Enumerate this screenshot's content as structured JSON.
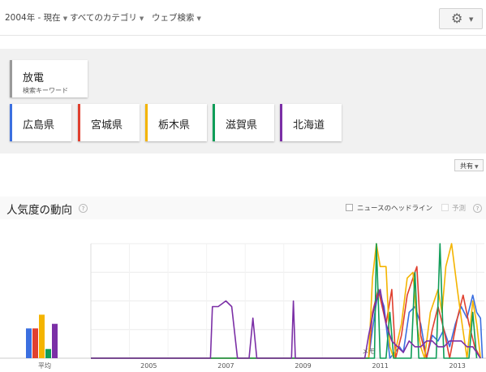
{
  "filters": {
    "time": "2004年 - 現在",
    "category": "すべてのカテゴリ",
    "search_type": "ウェブ検索"
  },
  "settings_icon": "gear-icon",
  "main_term": {
    "label": "放電",
    "sub": "検索キーワード"
  },
  "regions": [
    {
      "label": "広島県",
      "color": "#3b6fe0"
    },
    {
      "label": "宮城県",
      "color": "#e0402f"
    },
    {
      "label": "栃木県",
      "color": "#f4b400"
    },
    {
      "label": "滋賀県",
      "color": "#0f9d58"
    },
    {
      "label": "北海道",
      "color": "#7b2fa6"
    }
  ],
  "share_label": "共有",
  "section": {
    "title": "人気度の動向",
    "help": "?",
    "news_headlines": "ニュースのヘッドライン",
    "forecast": "予測"
  },
  "chart_data": {
    "type": "line",
    "x_ticks": [
      "2005",
      "2007",
      "2009",
      "2011",
      "2013"
    ],
    "average_label": "平均",
    "note_label": "メモ",
    "ylim": [
      0,
      100
    ],
    "average": [
      {
        "name": "広島県",
        "value": 26
      },
      {
        "name": "宮城県",
        "value": 26
      },
      {
        "name": "栃木県",
        "value": 38
      },
      {
        "name": "滋賀県",
        "value": 8
      },
      {
        "name": "北海道",
        "value": 30
      }
    ],
    "series": [
      {
        "name": "広島県",
        "points": [
          [
            2004.0,
            0
          ],
          [
            2011.2,
            0
          ],
          [
            2011.3,
            25
          ],
          [
            2011.45,
            60
          ],
          [
            2011.6,
            45
          ],
          [
            2011.75,
            0
          ],
          [
            2012.0,
            10
          ],
          [
            2012.1,
            5
          ],
          [
            2012.25,
            40
          ],
          [
            2012.4,
            45
          ],
          [
            2012.55,
            30
          ],
          [
            2012.7,
            0
          ],
          [
            2012.85,
            20
          ],
          [
            2013.0,
            15
          ],
          [
            2013.15,
            25
          ],
          [
            2013.3,
            10
          ],
          [
            2013.45,
            30
          ],
          [
            2013.6,
            45
          ],
          [
            2013.75,
            35
          ],
          [
            2013.9,
            55
          ],
          [
            2014.0,
            40
          ],
          [
            2014.1,
            35
          ],
          [
            2014.15,
            0
          ]
        ]
      },
      {
        "name": "宮城県",
        "points": [
          [
            2004.0,
            0
          ],
          [
            2011.2,
            0
          ],
          [
            2011.3,
            40
          ],
          [
            2011.45,
            60
          ],
          [
            2011.55,
            45
          ],
          [
            2011.65,
            30
          ],
          [
            2011.8,
            60
          ],
          [
            2011.9,
            0
          ],
          [
            2012.05,
            20
          ],
          [
            2012.2,
            55
          ],
          [
            2012.35,
            70
          ],
          [
            2012.45,
            80
          ],
          [
            2012.55,
            20
          ],
          [
            2012.7,
            0
          ],
          [
            2012.85,
            25
          ],
          [
            2013.0,
            45
          ],
          [
            2013.15,
            25
          ],
          [
            2013.3,
            0
          ],
          [
            2013.5,
            35
          ],
          [
            2013.65,
            55
          ],
          [
            2013.8,
            30
          ],
          [
            2013.95,
            10
          ],
          [
            2014.1,
            0
          ]
        ]
      },
      {
        "name": "栃木県",
        "points": [
          [
            2004.0,
            0
          ],
          [
            2011.2,
            0
          ],
          [
            2011.3,
            70
          ],
          [
            2011.4,
            100
          ],
          [
            2011.5,
            80
          ],
          [
            2011.65,
            80
          ],
          [
            2011.75,
            10
          ],
          [
            2011.85,
            0
          ],
          [
            2012.05,
            30
          ],
          [
            2012.2,
            70
          ],
          [
            2012.35,
            75
          ],
          [
            2012.45,
            30
          ],
          [
            2012.55,
            10
          ],
          [
            2012.65,
            0
          ],
          [
            2012.8,
            40
          ],
          [
            2013.0,
            60
          ],
          [
            2013.1,
            40
          ],
          [
            2013.2,
            80
          ],
          [
            2013.35,
            100
          ],
          [
            2013.5,
            60
          ],
          [
            2013.6,
            35
          ],
          [
            2013.75,
            0
          ],
          [
            2013.9,
            50
          ],
          [
            2014.0,
            30
          ],
          [
            2014.1,
            0
          ]
        ]
      },
      {
        "name": "滋賀県",
        "points": [
          [
            2004.0,
            0
          ],
          [
            2011.35,
            0
          ],
          [
            2011.4,
            100
          ],
          [
            2011.5,
            0
          ],
          [
            2011.65,
            0
          ],
          [
            2011.75,
            40
          ],
          [
            2011.85,
            0
          ],
          [
            2012.3,
            0
          ],
          [
            2012.4,
            75
          ],
          [
            2012.5,
            0
          ],
          [
            2012.95,
            0
          ],
          [
            2013.05,
            100
          ],
          [
            2013.15,
            0
          ],
          [
            2013.8,
            0
          ],
          [
            2013.9,
            40
          ],
          [
            2014.0,
            0
          ]
        ]
      },
      {
        "name": "北海道",
        "points": [
          [
            2004.0,
            0
          ],
          [
            2007.1,
            0
          ],
          [
            2007.15,
            45
          ],
          [
            2007.3,
            45
          ],
          [
            2007.5,
            50
          ],
          [
            2007.65,
            45
          ],
          [
            2007.8,
            0
          ],
          [
            2008.1,
            0
          ],
          [
            2008.2,
            35
          ],
          [
            2008.3,
            0
          ],
          [
            2009.2,
            0
          ],
          [
            2009.25,
            50
          ],
          [
            2009.3,
            0
          ],
          [
            2011.1,
            0
          ],
          [
            2011.2,
            20
          ],
          [
            2011.35,
            45
          ],
          [
            2011.5,
            60
          ],
          [
            2011.65,
            30
          ],
          [
            2011.8,
            15
          ],
          [
            2011.95,
            10
          ],
          [
            2012.1,
            5
          ],
          [
            2012.25,
            15
          ],
          [
            2012.4,
            10
          ],
          [
            2012.55,
            10
          ],
          [
            2012.7,
            15
          ],
          [
            2012.85,
            15
          ],
          [
            2013.0,
            10
          ],
          [
            2013.15,
            10
          ],
          [
            2013.3,
            15
          ],
          [
            2013.45,
            15
          ],
          [
            2013.6,
            15
          ],
          [
            2013.75,
            10
          ],
          [
            2013.9,
            10
          ],
          [
            2014.0,
            5
          ],
          [
            2014.1,
            0
          ]
        ]
      }
    ]
  }
}
